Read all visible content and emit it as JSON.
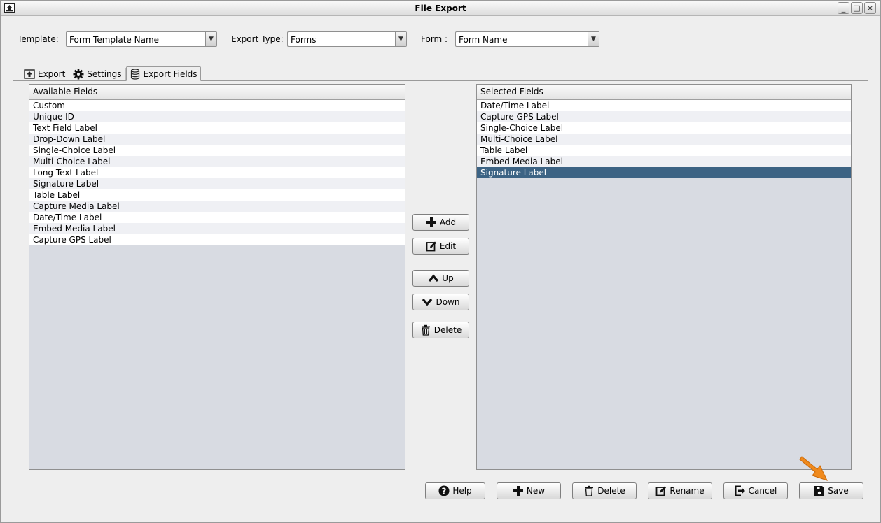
{
  "window": {
    "title": "File Export",
    "minimize_glyph": "_",
    "maximize_glyph": "□",
    "close_glyph": "×"
  },
  "top_form": {
    "template_label": "Template:",
    "template_value": "Form Template Name",
    "export_type_label": "Export Type:",
    "export_type_value": "Forms",
    "form_label": "Form :",
    "form_value": "Form Name",
    "dropdown_glyph": "▼"
  },
  "tabs": [
    {
      "label": "Export",
      "icon": "export-icon"
    },
    {
      "label": "Settings",
      "icon": "gear-icon"
    },
    {
      "label": "Export Fields",
      "icon": "database-icon",
      "active": true
    }
  ],
  "available_fields": {
    "header": "Available Fields",
    "items": [
      "Custom",
      "Unique ID",
      "Text Field Label",
      "Drop-Down Label",
      "Single-Choice Label",
      "Multi-Choice Label",
      "Long Text Label",
      "Signature Label",
      "Table Label",
      "Capture Media Label",
      "Date/Time Label",
      "Embed Media Label",
      "Capture GPS Label"
    ]
  },
  "selected_fields": {
    "header": "Selected Fields",
    "items": [
      "Date/Time Label",
      "Capture GPS Label",
      "Single-Choice Label",
      "Multi-Choice Label",
      "Table Label",
      "Embed Media Label",
      "Signature Label"
    ],
    "selected_index": 6
  },
  "middle_buttons": {
    "add": "Add",
    "edit": "Edit",
    "up": "Up",
    "down": "Down",
    "delete": "Delete"
  },
  "bottom_buttons": {
    "help": "Help",
    "new": "New",
    "delete": "Delete",
    "rename": "Rename",
    "cancel": "Cancel",
    "save": "Save"
  },
  "colors": {
    "selection": "#3c6384",
    "list_background": "#d8dbe2",
    "pointer_arrow": "#f08a1c"
  }
}
